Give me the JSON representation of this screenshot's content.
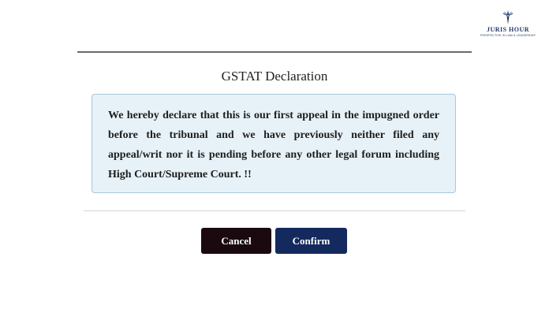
{
  "logo": {
    "icon": "lighthouse-pen-icon",
    "title": "JURIS HOUR",
    "tagline": "PERSPECTIVE IN LAW & LEADERSHIP"
  },
  "dialog": {
    "title": "GSTAT Declaration",
    "declaration": "We hereby declare that this is our first appeal in the impugned order before the tribunal and we have previously neither filed any appeal/writ nor it is pending before any other legal forum including High Court/Supreme Court. !!",
    "buttons": {
      "cancel": "Cancel",
      "confirm": "Confirm"
    }
  },
  "colors": {
    "box_background": "#e7f2f8",
    "box_border": "#a9c8da",
    "cancel_bg": "#1a0a10",
    "confirm_bg": "#142a5e",
    "logo": "#1f3763"
  }
}
